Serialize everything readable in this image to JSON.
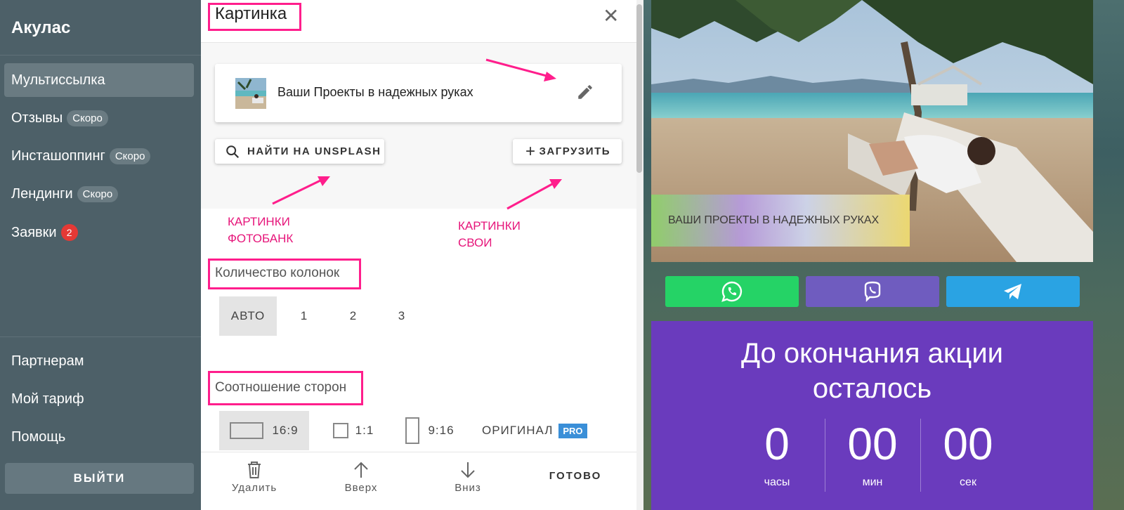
{
  "sidebar": {
    "brand": "Акулас",
    "items": [
      {
        "label": "Мультиссылка",
        "active": true
      },
      {
        "label": "Отзывы",
        "badge": "Скоро"
      },
      {
        "label": "Инсташоппинг",
        "badge": "Скоро"
      },
      {
        "label": "Лендинги",
        "badge": "Скоро"
      },
      {
        "label": "Заявки",
        "count": "2"
      }
    ],
    "bottom_items": [
      {
        "label": "Партнерам"
      },
      {
        "label": "Мой тариф"
      },
      {
        "label": "Помощь"
      }
    ],
    "logout_label": "ВЫЙТИ"
  },
  "editor": {
    "title": "Картинка",
    "image_card_text": "Ваши Проекты в надежных руках",
    "search_unsplash_label": "НАЙТИ НА UNSPLASH",
    "upload_label": "ЗАГРУЗИТЬ",
    "annotations": {
      "stock": [
        "КАРТИНКИ",
        "ФОТОБАНК"
      ],
      "own": [
        "КАРТИНКИ",
        "СВОИ"
      ]
    },
    "columns": {
      "title": "Количество колонок",
      "options": [
        "АВТО",
        "1",
        "2",
        "3"
      ],
      "selected": "АВТО"
    },
    "aspect": {
      "title": "Соотношение сторон",
      "options": [
        "16:9",
        "1:1",
        "9:16",
        "ОРИГИНАЛ"
      ],
      "pro_badge": "PRO",
      "selected": "16:9"
    },
    "bottom_bar": {
      "delete": "Удалить",
      "up": "Вверх",
      "down": "Вниз",
      "done": "ГОТОВО"
    }
  },
  "preview": {
    "banner_text": "ВАШИ ПРОЕКТЫ В НАДЕЖНЫХ РУКАХ",
    "countdown": {
      "title_line1": "До окончания акции",
      "title_line2": "осталось",
      "hours": "0",
      "minutes": "00",
      "seconds": "00",
      "hours_label": "часы",
      "minutes_label": "мин",
      "seconds_label": "сек"
    }
  },
  "colors": {
    "sidebar_bg": "#4d6068",
    "highlight": "#ff1e8c",
    "annotation": "#e6157a",
    "whatsapp": "#25d366",
    "viber": "#6f5cbf",
    "telegram": "#2aa3e3",
    "countdown_bg": "#6a3bbd",
    "pro_badge": "#3a8fd8"
  }
}
